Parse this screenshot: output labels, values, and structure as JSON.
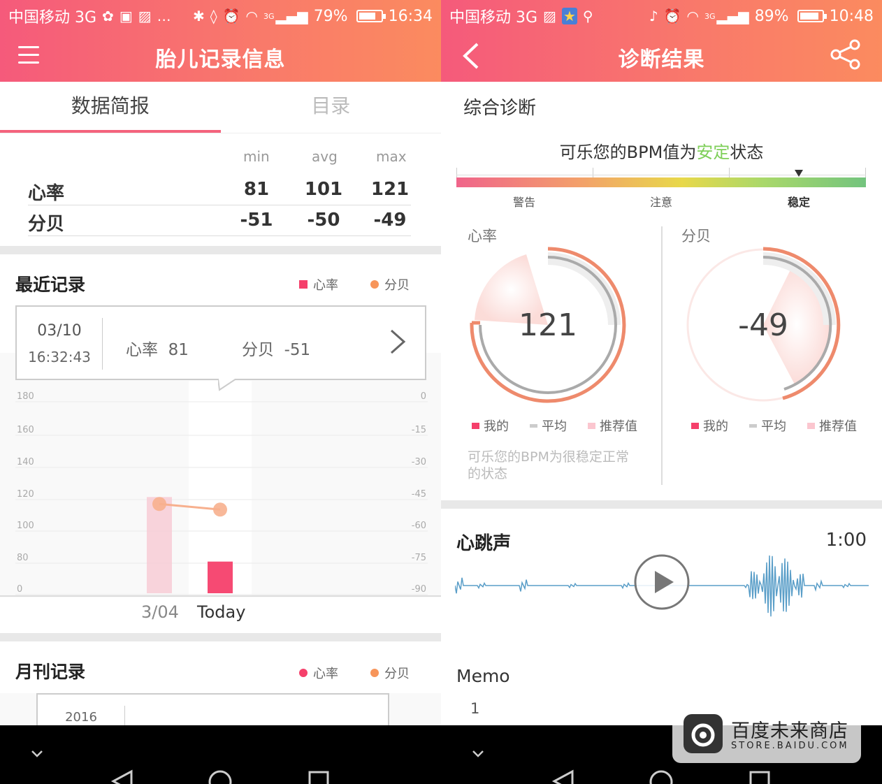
{
  "left": {
    "status": {
      "carrier": "中国移动 3G",
      "signal_label": "3G",
      "battery": "79%",
      "battery_level": 0.79,
      "time": "16:34"
    },
    "title": "胎儿记录信息",
    "tabs": [
      {
        "label": "数据简报"
      },
      {
        "label": "目录"
      }
    ],
    "summary": {
      "headers": [
        "min",
        "avg",
        "max"
      ],
      "rows": [
        {
          "label": "心率",
          "values": [
            "81",
            "101",
            "121"
          ]
        },
        {
          "label": "分贝",
          "values": [
            "-51",
            "-50",
            "-49"
          ]
        }
      ]
    },
    "recent": {
      "title": "最近记录",
      "legend": [
        "心率",
        "分贝"
      ],
      "card": {
        "date": "03/10",
        "time": "16:32:43",
        "hr_label": "心率",
        "hr_value": "81",
        "db_label": "分贝",
        "db_value": "-51"
      }
    },
    "chart_data": {
      "type": "bar",
      "categories": [
        "3/04",
        "Today"
      ],
      "y_left_ticks": [
        "180",
        "160",
        "140",
        "120",
        "100",
        "80",
        "0"
      ],
      "y_right_ticks": [
        "0",
        "-15",
        "-30",
        "-45",
        "-60",
        "-75",
        "-90"
      ],
      "series": [
        {
          "name": "心率",
          "kind": "bar",
          "values": [
            121,
            81
          ]
        },
        {
          "name": "分贝",
          "kind": "line",
          "values": [
            -49,
            -51
          ]
        }
      ]
    },
    "monthly": {
      "title": "月刊记录",
      "legend": [
        "心率",
        "分贝"
      ],
      "card_year": "2016"
    }
  },
  "right": {
    "status": {
      "carrier": "中国移动 3G",
      "signal_label": "3G",
      "battery": "89%",
      "battery_level": 0.89,
      "time": "10:48"
    },
    "title": "诊断结果",
    "section_title": "综合诊断",
    "bpm_line": {
      "prefix": "可乐您的BPM值为",
      "highlight": "安定",
      "suffix": "状态"
    },
    "scale_labels": [
      "警告",
      "注意",
      "稳定"
    ],
    "gauges": [
      {
        "label": "心率",
        "value": "121",
        "legend": [
          "我的",
          "平均",
          "推荐值"
        ]
      },
      {
        "label": "分贝",
        "value": "-49",
        "legend": [
          "我的",
          "平均",
          "推荐值"
        ]
      }
    ],
    "note": "可乐您的BPM为很稳定正常的状态",
    "heartbeat": {
      "title": "心跳声",
      "duration": "1:00"
    },
    "memo": {
      "label": "Memo",
      "value": "1"
    },
    "watermark": {
      "name": "百度未来商店",
      "url": "STORE.BAIDU.COM"
    }
  },
  "colors": {
    "accent": "#f4637d",
    "heart": "#f5406b",
    "decibel": "#f7955a",
    "gauge_ring": "#ee8a6c",
    "stable": "#7ecf58"
  }
}
